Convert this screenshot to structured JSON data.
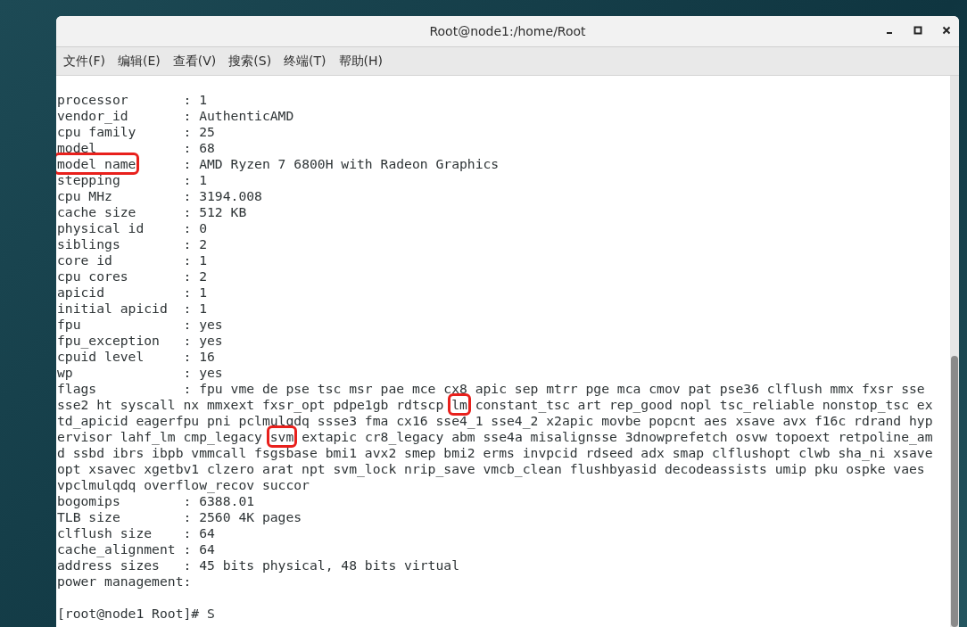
{
  "window": {
    "title": "Root@node1:/home/Root"
  },
  "menu": [
    "文件(F)",
    "编辑(E)",
    "查看(V)",
    "搜索(S)",
    "终端(T)",
    "帮助(H)"
  ],
  "terminal": {
    "lines": [
      [
        {
          "text": "processor       : 1",
          "boxed": false
        }
      ],
      [
        {
          "text": "vendor_id       : AuthenticAMD",
          "boxed": false
        }
      ],
      [
        {
          "text": "cpu family      : 25",
          "boxed": false
        }
      ],
      [
        {
          "text": "model           : 68",
          "boxed": false
        }
      ],
      [
        {
          "text": "model name",
          "boxed": true
        },
        {
          "text": "      : AMD Ryzen 7 6800H with Radeon Graphics",
          "boxed": false
        }
      ],
      [
        {
          "text": "stepping        : 1",
          "boxed": false
        }
      ],
      [
        {
          "text": "cpu MHz         : 3194.008",
          "boxed": false
        }
      ],
      [
        {
          "text": "cache size      : 512 KB",
          "boxed": false
        }
      ],
      [
        {
          "text": "physical id     : 0",
          "boxed": false
        }
      ],
      [
        {
          "text": "siblings        : 2",
          "boxed": false
        }
      ],
      [
        {
          "text": "core id         : 1",
          "boxed": false
        }
      ],
      [
        {
          "text": "cpu cores       : 2",
          "boxed": false
        }
      ],
      [
        {
          "text": "apicid          : 1",
          "boxed": false
        }
      ],
      [
        {
          "text": "initial apicid  : 1",
          "boxed": false
        }
      ],
      [
        {
          "text": "fpu             : yes",
          "boxed": false
        }
      ],
      [
        {
          "text": "fpu_exception   : yes",
          "boxed": false
        }
      ],
      [
        {
          "text": "cpuid level     : 16",
          "boxed": false
        }
      ],
      [
        {
          "text": "wp              : yes",
          "boxed": false
        }
      ],
      [
        {
          "text": "flags           : fpu vme de pse tsc msr pae mce cx8 apic sep mtrr pge mca cmov pat pse36 clflush mmx fxsr sse",
          "boxed": false
        }
      ],
      [
        {
          "text": "sse2 ht syscall nx mmxext fxsr_opt pdpe1gb rdtscp ",
          "boxed": false
        },
        {
          "text": "lm",
          "boxed": true
        },
        {
          "text": " constant_tsc art rep_good nopl tsc_reliable nonstop_tsc ex",
          "boxed": false
        }
      ],
      [
        {
          "text": "td_apicid eagerfpu pni pclmulqdq ssse3 fma cx16 sse4_1 sse4_2 x2apic movbe popcnt aes xsave avx f16c rdrand hyp",
          "boxed": false
        }
      ],
      [
        {
          "text": "ervisor lahf_lm cmp_legacy ",
          "boxed": false
        },
        {
          "text": "svm",
          "boxed": true
        },
        {
          "text": " extapic cr8_legacy abm sse4a misalignsse 3dnowprefetch osvw topoext retpoline_am",
          "boxed": false
        }
      ],
      [
        {
          "text": "d ssbd ibrs ibpb vmmcall fsgsbase bmi1 avx2 smep bmi2 erms invpcid rdseed adx smap clflushopt clwb sha_ni xsave",
          "boxed": false
        }
      ],
      [
        {
          "text": "opt xsavec xgetbv1 clzero arat npt svm_lock nrip_save vmcb_clean flushbyasid decodeassists umip pku ospke vaes",
          "boxed": false
        }
      ],
      [
        {
          "text": "vpclmulqdq overflow_recov succor",
          "boxed": false
        }
      ],
      [
        {
          "text": "bogomips        : 6388.01",
          "boxed": false
        }
      ],
      [
        {
          "text": "TLB size        : 2560 4K pages",
          "boxed": false
        }
      ],
      [
        {
          "text": "clflush size    : 64",
          "boxed": false
        }
      ],
      [
        {
          "text": "cache_alignment : 64",
          "boxed": false
        }
      ],
      [
        {
          "text": "address sizes   : 45 bits physical, 48 bits virtual",
          "boxed": false
        }
      ],
      [
        {
          "text": "power management:",
          "boxed": false
        }
      ],
      {
        "kind": "prompt",
        "segments": [
          {
            "text": "[root@node1 Root]# S",
            "boxed": false
          }
        ]
      }
    ]
  }
}
